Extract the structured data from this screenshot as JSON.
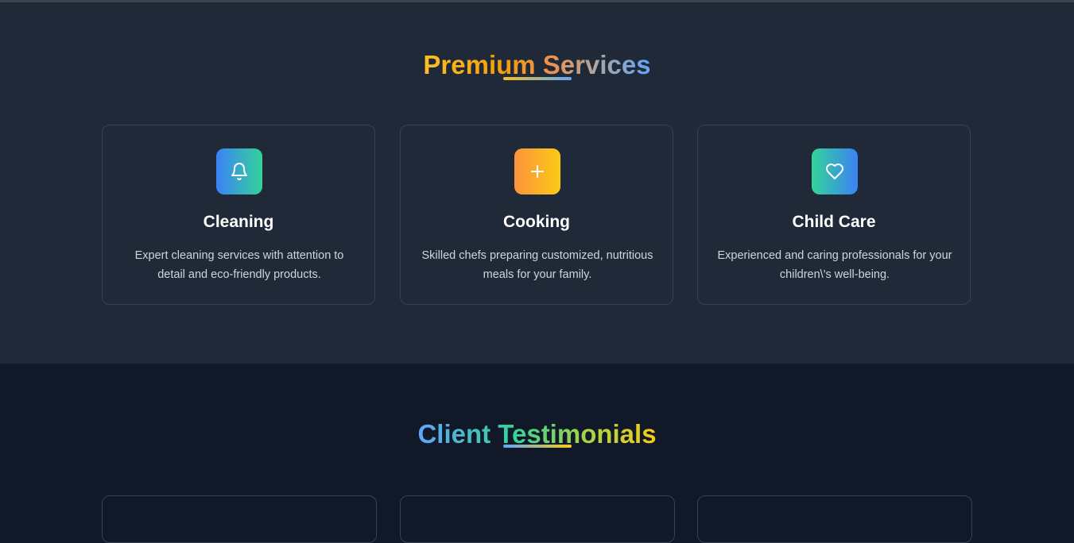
{
  "services": {
    "title": "Premium Services",
    "cards": [
      {
        "icon": "bell-icon",
        "title": "Cleaning",
        "description": "Expert cleaning services with attention to detail and eco-friendly products."
      },
      {
        "icon": "plus-icon",
        "title": "Cooking",
        "description": "Skilled chefs preparing customized, nutritious meals for your family."
      },
      {
        "icon": "heart-icon",
        "title": "Child Care",
        "description": "Experienced and caring professionals for your children\\'s well-being."
      }
    ]
  },
  "testimonials": {
    "title": "Client Testimonials"
  },
  "colors": {
    "services_bg": "#1f2937",
    "testimonials_bg": "#111827",
    "accent_gold": "#fbbf24",
    "accent_blue": "#60a5fa",
    "accent_green": "#34d399",
    "accent_orange": "#fb923c"
  }
}
